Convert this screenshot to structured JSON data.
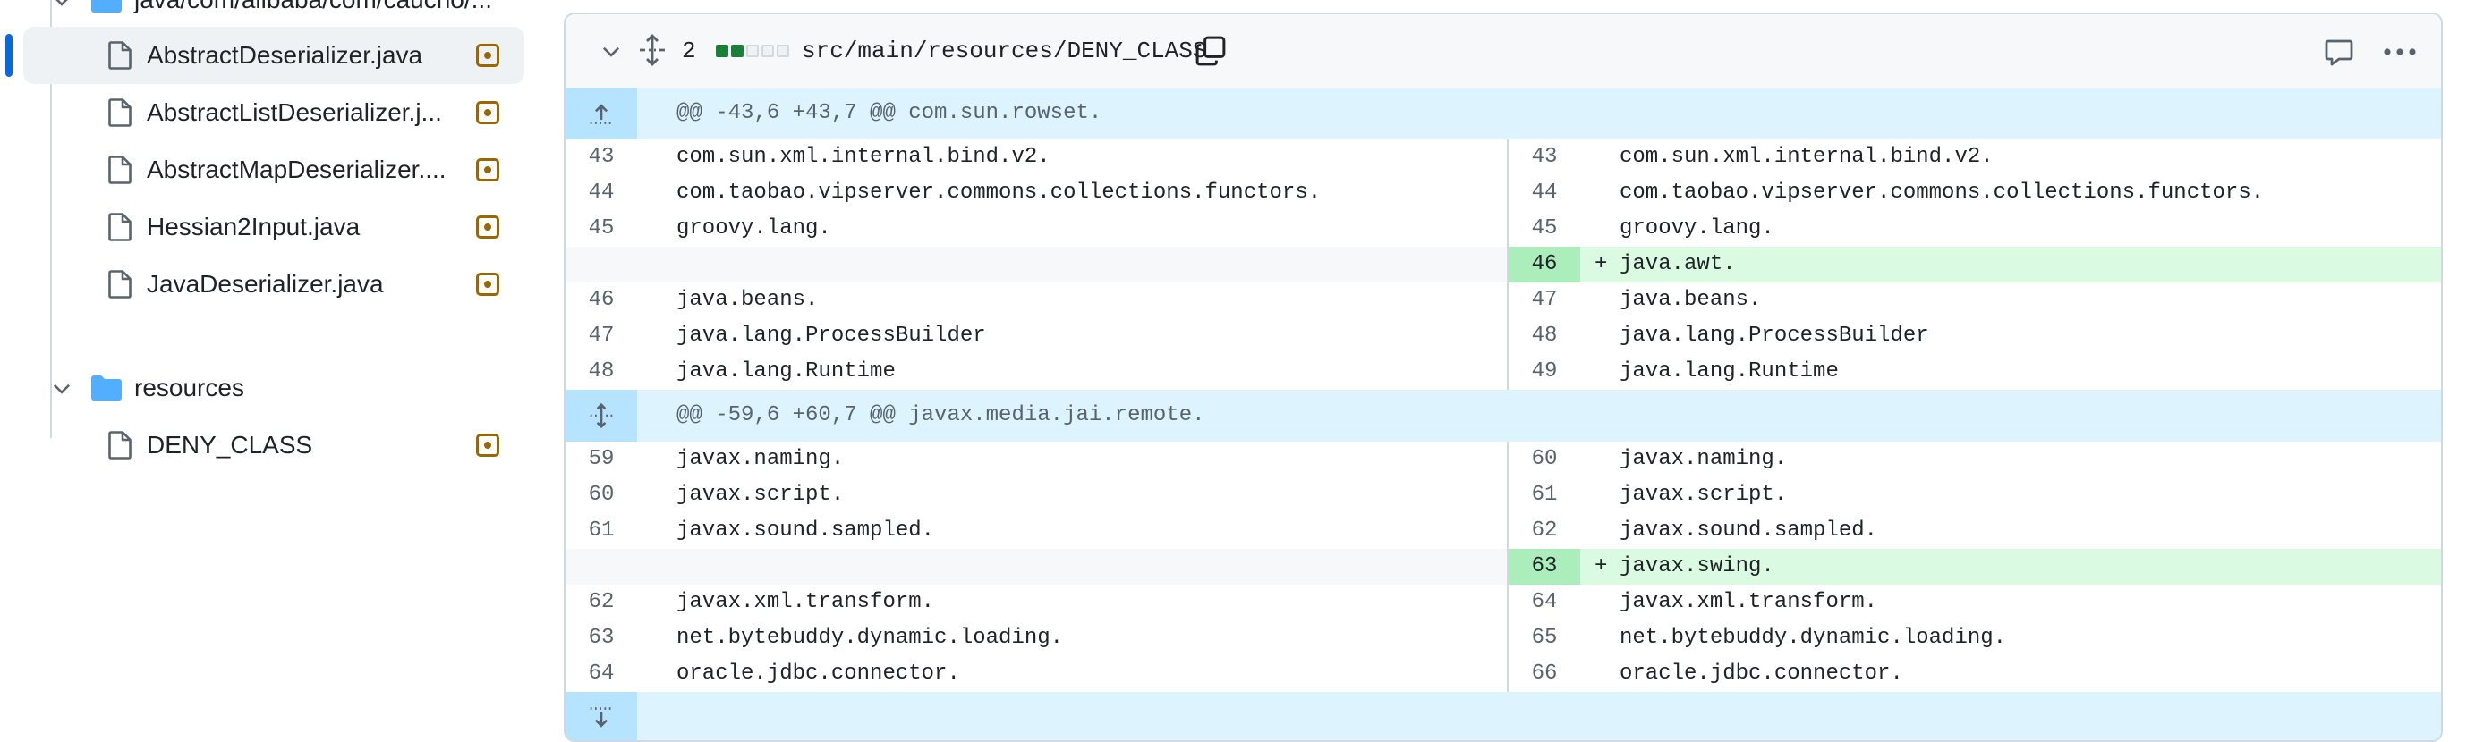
{
  "sidebar": {
    "top_folder_label": "java/com/alibaba/com/caucho/...",
    "files": [
      {
        "label": "AbstractDeserializer.java",
        "selected": true
      },
      {
        "label": "AbstractListDeserializer.j...",
        "selected": false
      },
      {
        "label": "AbstractMapDeserializer....",
        "selected": false
      },
      {
        "label": "Hessian2Input.java",
        "selected": false
      },
      {
        "label": "JavaDeserializer.java",
        "selected": false
      }
    ],
    "resources_folder": {
      "label": "resources"
    },
    "resource_files": [
      {
        "label": "DENY_CLASS"
      }
    ]
  },
  "diff": {
    "change_count": "2",
    "diffstat": {
      "added_blocks": 2,
      "neutral_blocks": 3
    },
    "file_path": "src/main/resources/DENY_CLASS",
    "hunk1": "@@ -43,6 +43,7 @@ com.sun.rowset.",
    "hunk2": "@@ -59,6 +60,7 @@ javax.media.jai.remote.",
    "rows1": [
      {
        "l_num": "43",
        "l_code": "com.sun.xml.internal.bind.v2.",
        "r_num": "43",
        "r_code": "com.sun.xml.internal.bind.v2."
      },
      {
        "l_num": "44",
        "l_code": "com.taobao.vipserver.commons.collections.functors.",
        "r_num": "44",
        "r_code": "com.taobao.vipserver.commons.collections.functors."
      },
      {
        "l_num": "45",
        "l_code": "groovy.lang.",
        "r_num": "45",
        "r_code": "groovy.lang."
      },
      {
        "l_num": "",
        "l_code": "",
        "r_num": "46",
        "r_code": "java.awt.",
        "added": true,
        "marker": "+"
      },
      {
        "l_num": "46",
        "l_code": "java.beans.",
        "r_num": "47",
        "r_code": "java.beans."
      },
      {
        "l_num": "47",
        "l_code": "java.lang.ProcessBuilder",
        "r_num": "48",
        "r_code": "java.lang.ProcessBuilder"
      },
      {
        "l_num": "48",
        "l_code": "java.lang.Runtime",
        "r_num": "49",
        "r_code": "java.lang.Runtime"
      }
    ],
    "rows2": [
      {
        "l_num": "59",
        "l_code": "javax.naming.",
        "r_num": "60",
        "r_code": "javax.naming."
      },
      {
        "l_num": "60",
        "l_code": "javax.script.",
        "r_num": "61",
        "r_code": "javax.script."
      },
      {
        "l_num": "61",
        "l_code": "javax.sound.sampled.",
        "r_num": "62",
        "r_code": "javax.sound.sampled."
      },
      {
        "l_num": "",
        "l_code": "",
        "r_num": "63",
        "r_code": "javax.swing.",
        "added": true,
        "marker": "+"
      },
      {
        "l_num": "62",
        "l_code": "javax.xml.transform.",
        "r_num": "64",
        "r_code": "javax.xml.transform."
      },
      {
        "l_num": "63",
        "l_code": "net.bytebuddy.dynamic.loading.",
        "r_num": "65",
        "r_code": "net.bytebuddy.dynamic.loading."
      },
      {
        "l_num": "64",
        "l_code": "oracle.jdbc.connector.",
        "r_num": "66",
        "r_code": "oracle.jdbc.connector."
      }
    ]
  },
  "colors": {
    "accent": "#0969da",
    "modified_badge": "#9a6700",
    "folder": "#54aeff",
    "hunk_bg": "#ddf4ff",
    "added_bg": "#dafbe1"
  },
  "icons": [
    "file-icon",
    "folder-icon",
    "chevron-down-icon",
    "modified-icon",
    "expand-icon",
    "copy-icon",
    "comment-icon",
    "kebab-icon",
    "expand-up-icon",
    "expand-down-icon"
  ]
}
